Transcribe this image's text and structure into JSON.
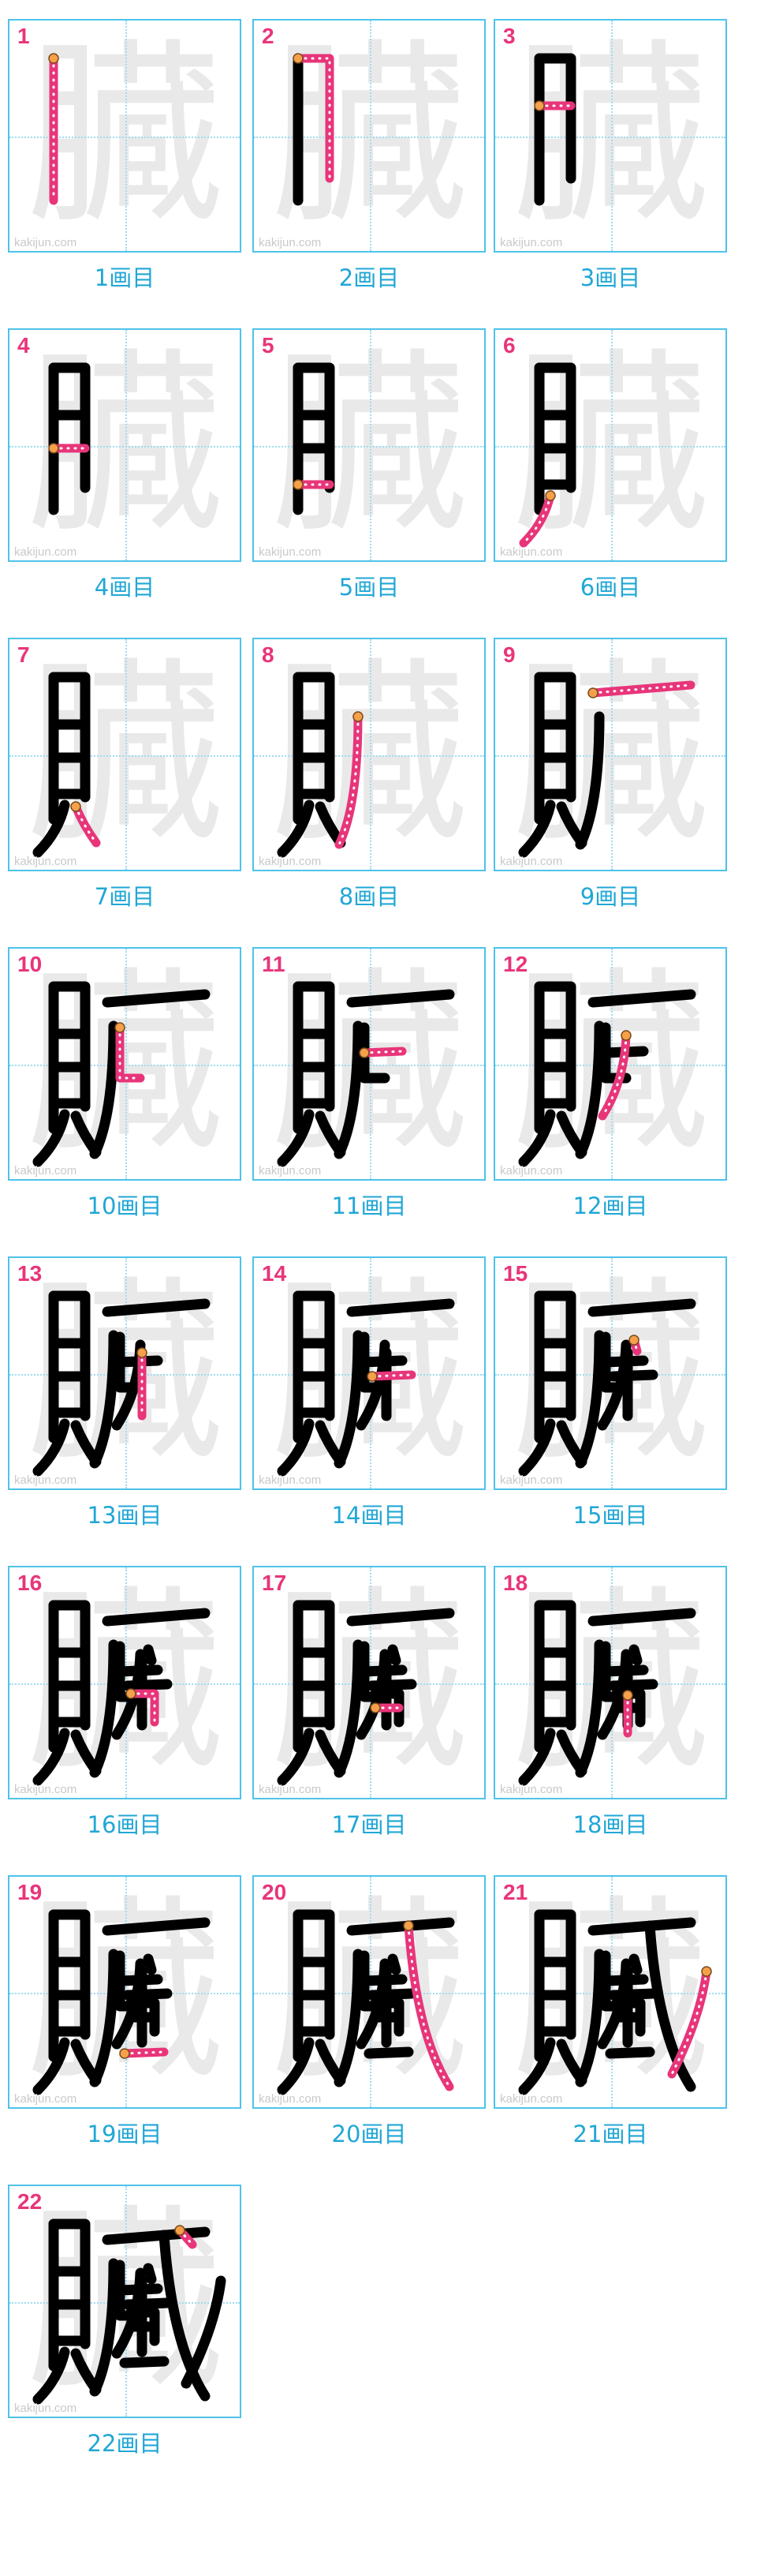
{
  "character": "臓",
  "watermark": "kakijun.com",
  "caption_suffix": "画目",
  "colors": {
    "border": "#4ec3ea",
    "stroke_number": "#e8357a",
    "caption": "#21a7d6",
    "current_stroke": "#e8357a",
    "ghost": "#e9e9e9",
    "written": "#000000"
  },
  "steps": [
    {
      "n": "1",
      "caption_num": "1"
    },
    {
      "n": "2",
      "caption_num": "2"
    },
    {
      "n": "3",
      "caption_num": "3"
    },
    {
      "n": "4",
      "caption_num": "4"
    },
    {
      "n": "5",
      "caption_num": "5"
    },
    {
      "n": "6",
      "caption_num": "6"
    },
    {
      "n": "7",
      "caption_num": "7"
    },
    {
      "n": "8",
      "caption_num": "8"
    },
    {
      "n": "9",
      "caption_num": "9"
    },
    {
      "n": "10",
      "caption_num": "10"
    },
    {
      "n": "11",
      "caption_num": "11"
    },
    {
      "n": "12",
      "caption_num": "12"
    },
    {
      "n": "13",
      "caption_num": "13"
    },
    {
      "n": "14",
      "caption_num": "14"
    },
    {
      "n": "15",
      "caption_num": "15"
    },
    {
      "n": "16",
      "caption_num": "16"
    },
    {
      "n": "17",
      "caption_num": "17"
    },
    {
      "n": "18",
      "caption_num": "18"
    },
    {
      "n": "19",
      "caption_num": "19"
    },
    {
      "n": "20",
      "caption_num": "20"
    },
    {
      "n": "21",
      "caption_num": "21"
    },
    {
      "n": "22",
      "caption_num": "22"
    }
  ]
}
